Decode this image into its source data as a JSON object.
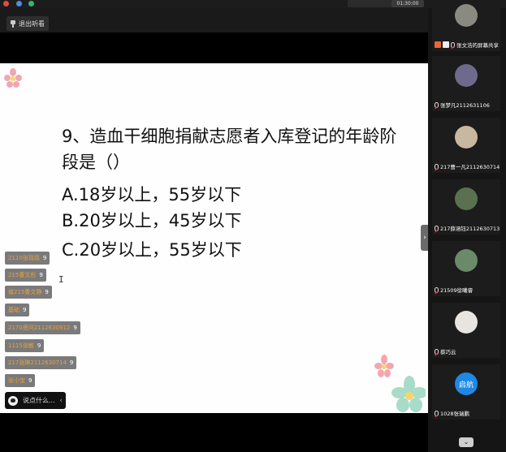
{
  "toolbar": {
    "exit_label": "退出听看"
  },
  "status": {
    "clock": "01:30:00"
  },
  "slide": {
    "question": "9、造血干细胞捐献志愿者入库登记的年龄阶段是（）",
    "options": [
      "A.18岁以上，55岁以下",
      "B.20岁以上，45岁以下",
      "C.20岁以上，55岁以下"
    ]
  },
  "chat": {
    "messages": [
      {
        "name": "2110张瑶瑶",
        "text": "9"
      },
      {
        "name": "215曹文彤",
        "text": "9"
      },
      {
        "name": "值215曹文静",
        "text": "9"
      },
      {
        "name": "基础",
        "text": "9"
      },
      {
        "name": "2170思问2112630912",
        "text": "9"
      },
      {
        "name": "1115张敏",
        "text": "9"
      },
      {
        "name": "217张琳2112630714",
        "text": "9"
      },
      {
        "name": "张小宝",
        "text": "9"
      }
    ],
    "input_placeholder": "说点什么...",
    "collapse_glyph": "‹"
  },
  "participants": [
    {
      "name": "张文浩的屏幕共享",
      "avatar_color": "#8a8a80",
      "host": true
    },
    {
      "name": "张梦凡2112631106",
      "avatar_color": "#6e6a8c",
      "host": false
    },
    {
      "name": "217曹一凡2112630714",
      "avatar_color": "#c8b8a0",
      "host": false
    },
    {
      "name": "217薛涵钰2112630713",
      "avatar_color": "#5a7050",
      "host": false
    },
    {
      "name": "21509徐曦睿",
      "avatar_color": "#6a8a6a",
      "host": false
    },
    {
      "name": "蔡巧云",
      "avatar_color": "#e8e4e0",
      "host": false
    },
    {
      "name": "1028张瑞鹏",
      "avatar_text": "启航",
      "avatar_color": "#1e88e5",
      "host": false
    }
  ],
  "collapse_handle": "›",
  "scroll_down_glyph": "⌄",
  "colors": {
    "slide_bg": "#fefefe",
    "chat_name": "#e8a040",
    "launch_blue": "#1e88e5"
  },
  "icons": [
    "pin-icon",
    "mic-muted-icon",
    "host-icon",
    "chevron-left-icon",
    "chevron-right-icon",
    "chevron-down-icon"
  ]
}
